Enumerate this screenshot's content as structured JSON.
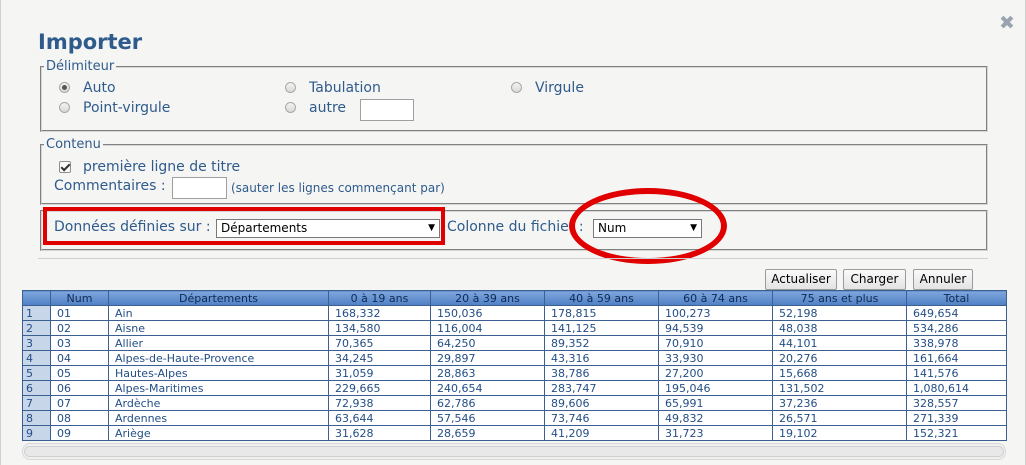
{
  "dialog": {
    "title": "Importer",
    "close_glyph": "✖"
  },
  "delimiter": {
    "legend": "Délimiteur",
    "options": [
      "Auto",
      "Tabulation",
      "Virgule",
      "Point-virgule",
      "autre"
    ],
    "selected": "Auto",
    "other_value": ""
  },
  "content": {
    "legend": "Contenu",
    "first_line_title_label": "première ligne de titre",
    "first_line_title_checked": true,
    "comments_label": "Commentaires :",
    "comments_value": "",
    "comments_hint": "(sauter les lignes commençant par)"
  },
  "mapping": {
    "data_defined_label": "Données définies sur :",
    "data_defined_value": "Départements",
    "file_column_label": "Colonne du fichier :",
    "file_column_value": "Num"
  },
  "buttons": {
    "refresh": "Actualiser",
    "load": "Charger",
    "cancel": "Annuler"
  },
  "table": {
    "headers": [
      "",
      "Num",
      "Départements",
      "0 à 19 ans",
      "20 à 39 ans",
      "40 à 59 ans",
      "60 à 74 ans",
      "75 ans et plus",
      "Total"
    ],
    "rows": [
      [
        "1",
        "01",
        "Ain",
        "168,332",
        "150,036",
        "178,815",
        "100,273",
        "52,198",
        "649,654"
      ],
      [
        "2",
        "02",
        "Aisne",
        "134,580",
        "116,004",
        "141,125",
        "94,539",
        "48,038",
        "534,286"
      ],
      [
        "3",
        "03",
        "Allier",
        "70,365",
        "64,250",
        "89,352",
        "70,910",
        "44,101",
        "338,978"
      ],
      [
        "4",
        "04",
        "Alpes-de-Haute-Provence",
        "34,245",
        "29,897",
        "43,316",
        "33,930",
        "20,276",
        "161,664"
      ],
      [
        "5",
        "05",
        "Hautes-Alpes",
        "31,059",
        "28,863",
        "38,786",
        "27,200",
        "15,668",
        "141,576"
      ],
      [
        "6",
        "06",
        "Alpes-Maritimes",
        "229,665",
        "240,654",
        "283,747",
        "195,046",
        "131,502",
        "1,080,614"
      ],
      [
        "7",
        "07",
        "Ardèche",
        "72,938",
        "62,786",
        "89,606",
        "65,991",
        "37,236",
        "328,557"
      ],
      [
        "8",
        "08",
        "Ardennes",
        "63,644",
        "57,546",
        "73,746",
        "49,832",
        "26,571",
        "271,339"
      ],
      [
        "9",
        "09",
        "Ariège",
        "31,628",
        "28,659",
        "41,209",
        "31,723",
        "19,102",
        "152,321"
      ]
    ]
  },
  "colors": {
    "title": "#2e5b8c",
    "annotation": "#e00000",
    "header": "#4f7fc4"
  }
}
